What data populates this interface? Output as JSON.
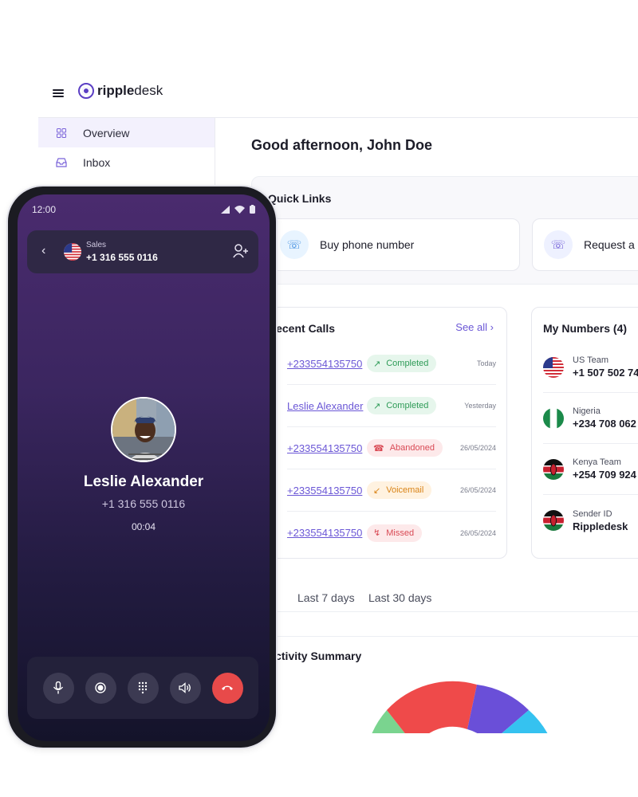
{
  "app": {
    "logo_bold": "ripple",
    "logo_light": "desk"
  },
  "sidebar": {
    "items": [
      {
        "label": "Overview",
        "icon": "grid-icon"
      },
      {
        "label": "Inbox",
        "icon": "inbox-icon"
      }
    ]
  },
  "main": {
    "greeting": "Good afternoon, John Doe",
    "quick_links": {
      "title": "Quick Links",
      "items": [
        {
          "label": "Buy phone number",
          "icon": "phone-buy-icon"
        },
        {
          "label": "Request a",
          "icon": "request-icon"
        }
      ]
    },
    "recent_calls": {
      "title": "Recent Calls",
      "see_all": "See all",
      "rows": [
        {
          "number": "+233554135750",
          "status": "Completed",
          "date": "Today"
        },
        {
          "number": "Leslie Alexander",
          "status": "Completed",
          "date": "Yesterday"
        },
        {
          "number": "+233554135750",
          "status": "Abandoned",
          "date": "26/05/2024"
        },
        {
          "number": "+233554135750",
          "status": "Voicemail",
          "date": "26/05/2024"
        },
        {
          "number": "+233554135750",
          "status": "Missed",
          "date": "26/05/2024"
        }
      ]
    },
    "my_numbers": {
      "title": "My Numbers (4)",
      "rows": [
        {
          "name": "US Team",
          "number": "+1 507 502 74",
          "flag": "us"
        },
        {
          "name": "Nigeria",
          "number": "+234 708 062",
          "flag": "ng"
        },
        {
          "name": "Kenya Team",
          "number": "+254 709 924",
          "flag": "ke"
        },
        {
          "name": "Sender ID",
          "number": "Rippledesk",
          "flag": "ke"
        }
      ]
    },
    "range_tabs": [
      "Last 7 days",
      "Last 30 days"
    ],
    "activity": {
      "title": "Activity Summary",
      "colors": {
        "red": "#ef4a4a",
        "purple": "#6a4fd8",
        "cyan": "#35c2f0",
        "green": "#7ad48f"
      }
    }
  },
  "phone": {
    "time": "12:00",
    "line_label": "Sales",
    "line_number": "+1 316 555 0116",
    "caller_name": "Leslie Alexander",
    "caller_number": "+1 316 555 0116",
    "duration": "00:04",
    "controls": [
      "microphone-icon",
      "record-icon",
      "keypad-icon",
      "speaker-icon",
      "end-call-icon"
    ]
  },
  "colors": {
    "accent": "#6b57d6",
    "end_call": "#e84a4a"
  }
}
